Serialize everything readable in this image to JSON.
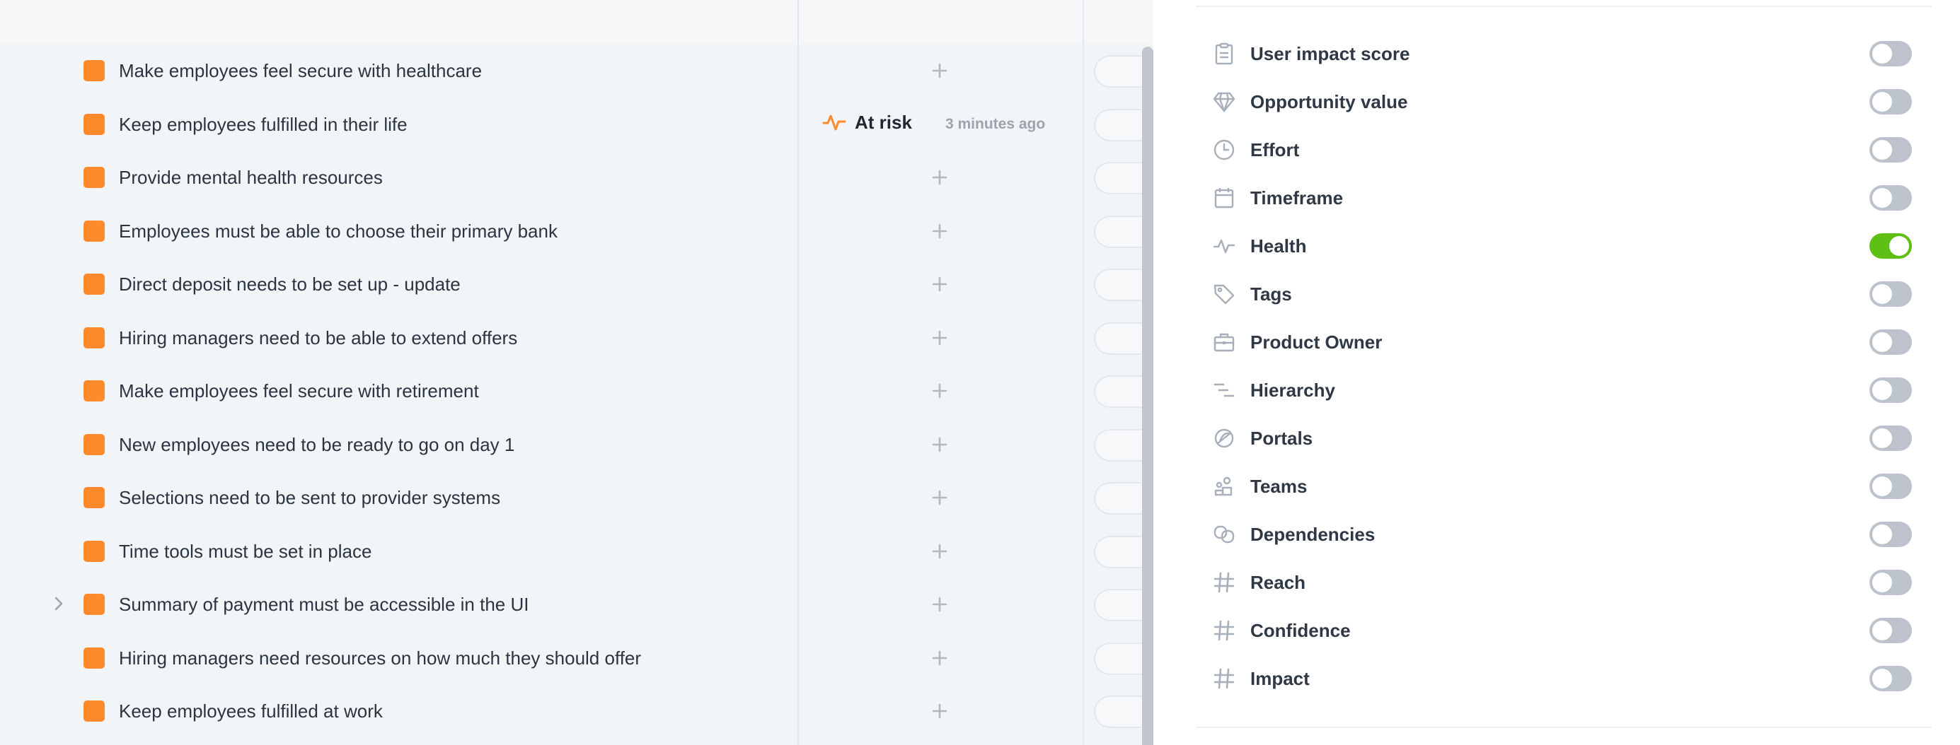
{
  "list": {
    "rows": [
      {
        "title": "Make employees feel secure with healthcare",
        "health": null
      },
      {
        "title": "Keep employees fulfilled in their life",
        "health": {
          "label": "At risk",
          "time": "3 minutes ago"
        }
      },
      {
        "title": "Provide mental health resources",
        "health": null
      },
      {
        "title": "Employees must be able to choose their primary bank",
        "health": null
      },
      {
        "title": "Direct deposit needs to be set up - update",
        "health": null
      },
      {
        "title": "Hiring managers need to be able to extend offers",
        "health": null
      },
      {
        "title": "Make employees feel secure with retirement",
        "health": null
      },
      {
        "title": "New employees need to be ready to go on day 1",
        "health": null
      },
      {
        "title": "Selections need to be sent to provider systems",
        "health": null
      },
      {
        "title": "Time tools must be set in place",
        "health": null
      },
      {
        "title": "Summary of payment must be accessible in the UI",
        "health": null,
        "expandable": true
      },
      {
        "title": "Hiring managers need resources on how much they should offer",
        "health": null
      },
      {
        "title": "Keep employees fulfilled at work",
        "health": null
      }
    ]
  },
  "panel": {
    "fields": [
      {
        "label": "User impact score",
        "icon": "clipboard-icon",
        "on": false
      },
      {
        "label": "Opportunity value",
        "icon": "diamond-icon",
        "on": false
      },
      {
        "label": "Effort",
        "icon": "clock-icon",
        "on": false
      },
      {
        "label": "Timeframe",
        "icon": "calendar-icon",
        "on": false
      },
      {
        "label": "Health",
        "icon": "pulse-icon",
        "on": true
      },
      {
        "label": "Tags",
        "icon": "tag-icon",
        "on": false
      },
      {
        "label": "Product Owner",
        "icon": "briefcase-icon",
        "on": false
      },
      {
        "label": "Hierarchy",
        "icon": "hierarchy-icon",
        "on": false
      },
      {
        "label": "Portals",
        "icon": "portal-icon",
        "on": false
      },
      {
        "label": "Teams",
        "icon": "teams-icon",
        "on": false
      },
      {
        "label": "Dependencies",
        "icon": "dependencies-icon",
        "on": false
      },
      {
        "label": "Reach",
        "icon": "hash-icon",
        "on": false
      },
      {
        "label": "Confidence",
        "icon": "hash-icon",
        "on": false
      },
      {
        "label": "Impact",
        "icon": "hash-icon",
        "on": false
      }
    ]
  },
  "colors": {
    "accent_orange": "#ff8a2b",
    "toggle_on": "#5ec015",
    "toggle_off": "#bcc3cc"
  }
}
